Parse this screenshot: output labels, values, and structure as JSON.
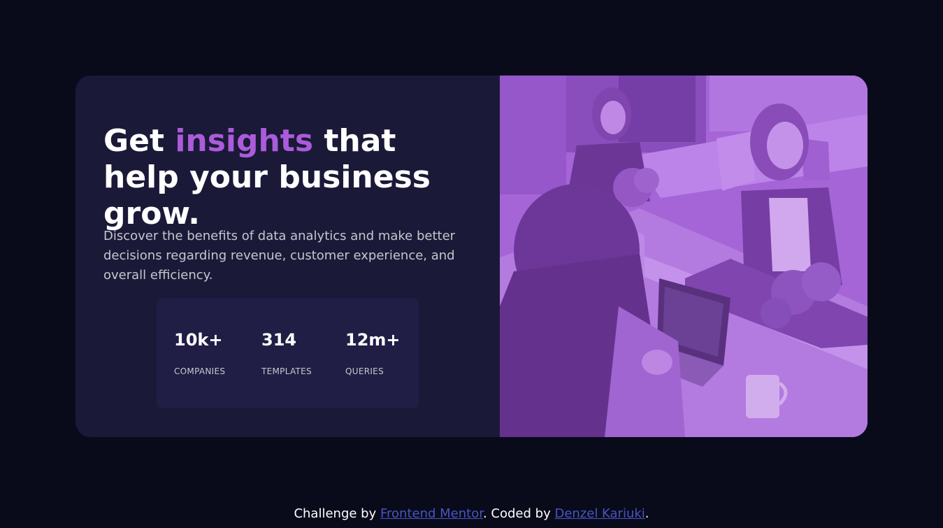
{
  "hero": {
    "headline_pre": "Get ",
    "headline_accent": "insights",
    "headline_post": " that help your business grow.",
    "description": "Discover the benefits of data analytics and make better decisions regarding revenue, customer experience, and overall efficiency."
  },
  "stats": [
    {
      "value": "10k+",
      "label": "COMPANIES"
    },
    {
      "value": "314",
      "label": "TEMPLATES"
    },
    {
      "value": "12m+",
      "label": "QUERIES"
    }
  ],
  "footer": {
    "text1": "Challenge by ",
    "link1": "Frontend Mentor",
    "text2": ". Coded by ",
    "link2": "Denzel Kariuki",
    "text3": "."
  },
  "colors": {
    "background": "#090b1a",
    "card": "#1b1938",
    "stats_box": "#201e44",
    "accent": "#aa5cdb",
    "link": "#4953c4"
  }
}
